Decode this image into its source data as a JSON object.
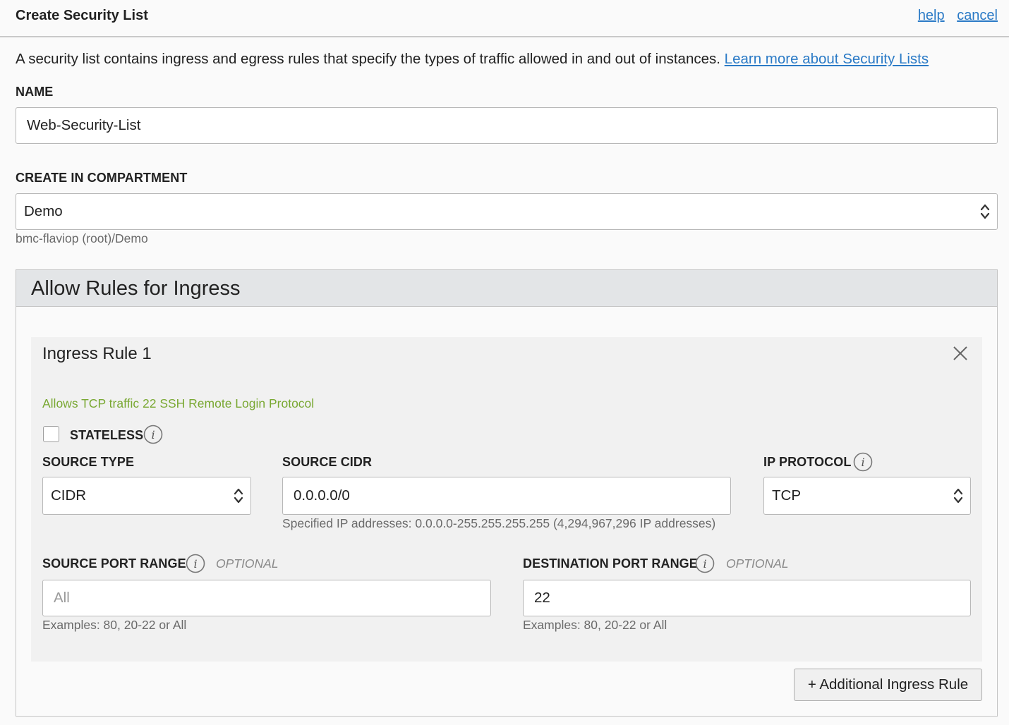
{
  "header": {
    "title": "Create Security List",
    "help_link": "help",
    "cancel_link": "cancel"
  },
  "intro": {
    "text": "A security list contains ingress and egress rules that specify the types of traffic allowed in and out of instances.",
    "learn_more": "Learn more about Security Lists"
  },
  "name_field": {
    "label": "NAME",
    "value": "Web-Security-List"
  },
  "compartment": {
    "label": "CREATE IN COMPARTMENT",
    "selected": "Demo",
    "path_hint": "bmc-flaviop (root)/Demo"
  },
  "ingress_panel": {
    "title": "Allow Rules for Ingress",
    "add_button": "+ Additional Ingress Rule",
    "rules": [
      {
        "title": "Ingress Rule 1",
        "description": "Allows TCP traffic 22 SSH Remote Login Protocol",
        "stateless_label": "STATELESS",
        "stateless_checked": false,
        "source_type": {
          "label": "SOURCE TYPE",
          "selected": "CIDR"
        },
        "source_cidr": {
          "label": "SOURCE CIDR",
          "value": "0.0.0.0/0",
          "hint": "Specified IP addresses: 0.0.0.0-255.255.255.255 (4,294,967,296 IP addresses)"
        },
        "ip_protocol": {
          "label": "IP PROTOCOL",
          "selected": "TCP"
        },
        "source_port_range": {
          "label": "SOURCE PORT RANGE",
          "optional": "OPTIONAL",
          "placeholder": "All",
          "value": "",
          "hint": "Examples: 80, 20-22 or All"
        },
        "destination_port_range": {
          "label": "DESTINATION PORT RANGE",
          "optional": "OPTIONAL",
          "value": "22",
          "hint": "Examples: 80, 20-22 or All"
        }
      }
    ]
  },
  "colors": {
    "link": "#2a7ac6",
    "rule_description": "#79a832",
    "panel_header_bg": "#e3e5e7",
    "rule_box_bg": "#f1f1f1"
  },
  "icons": {
    "select_arrows": "up-down-chevron-icon",
    "close": "close-icon",
    "info": "info-icon"
  }
}
